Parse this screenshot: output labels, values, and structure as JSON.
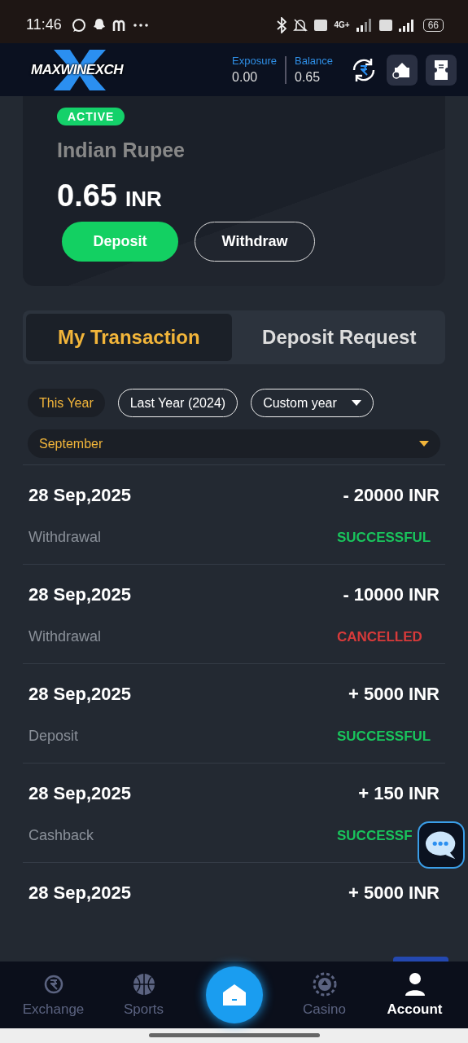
{
  "status_bar": {
    "time": "11:46",
    "network_type": "4G+",
    "battery": "66"
  },
  "header": {
    "logo": "MAXWINEXCH",
    "exposure": {
      "label": "Exposure",
      "value": "0.00"
    },
    "balance": {
      "label": "Balance",
      "value": "0.65"
    }
  },
  "wallet": {
    "badge": "ACTIVE",
    "currency": "Indian Rupee",
    "amount": "0.65",
    "unit": "INR",
    "buttons": [
      {
        "label": "Deposit",
        "kind": "primary"
      },
      {
        "label": "Withdraw",
        "kind": "outline"
      }
    ]
  },
  "tabs": [
    {
      "label": "My Transaction",
      "selected": true
    },
    {
      "label": "Deposit Request",
      "selected": false
    }
  ],
  "filters": [
    {
      "label": "This Year",
      "selected": true
    },
    {
      "label": "Last Year (2024)",
      "selected": false
    },
    {
      "label": "Custom year",
      "selected": false,
      "kind": "dropdown"
    }
  ],
  "month": {
    "value": "September"
  },
  "transactions": [
    {
      "date": "28 Sep,2025",
      "amount": "- 20000 INR",
      "type": "Withdrawal",
      "status": "SUCCESSFUL",
      "color": "#19c45c"
    },
    {
      "date": "28 Sep,2025",
      "amount": "- 10000 INR",
      "type": "Withdrawal",
      "status": "CANCELLED",
      "color": "#d83a3a"
    },
    {
      "date": "28 Sep,2025",
      "amount": "+ 5000 INR",
      "type": "Deposit",
      "status": "SUCCESSFUL",
      "color": "#19c45c"
    },
    {
      "date": "28 Sep,2025",
      "amount": "+ 150 INR",
      "type": "Cashback",
      "status": "SUCCESSF",
      "color": "#19c45c"
    },
    {
      "date": "28 Sep,2025",
      "amount": "+ 5000 INR"
    }
  ],
  "nav": [
    {
      "label": "Exchange",
      "kind": "exchange",
      "selected": false
    },
    {
      "label": "Sports",
      "kind": "sports",
      "selected": false
    },
    {
      "kind": "home",
      "selected": false
    },
    {
      "label": "Casino",
      "kind": "casino",
      "selected": false
    },
    {
      "label": "Account",
      "kind": "account",
      "selected": true
    }
  ]
}
